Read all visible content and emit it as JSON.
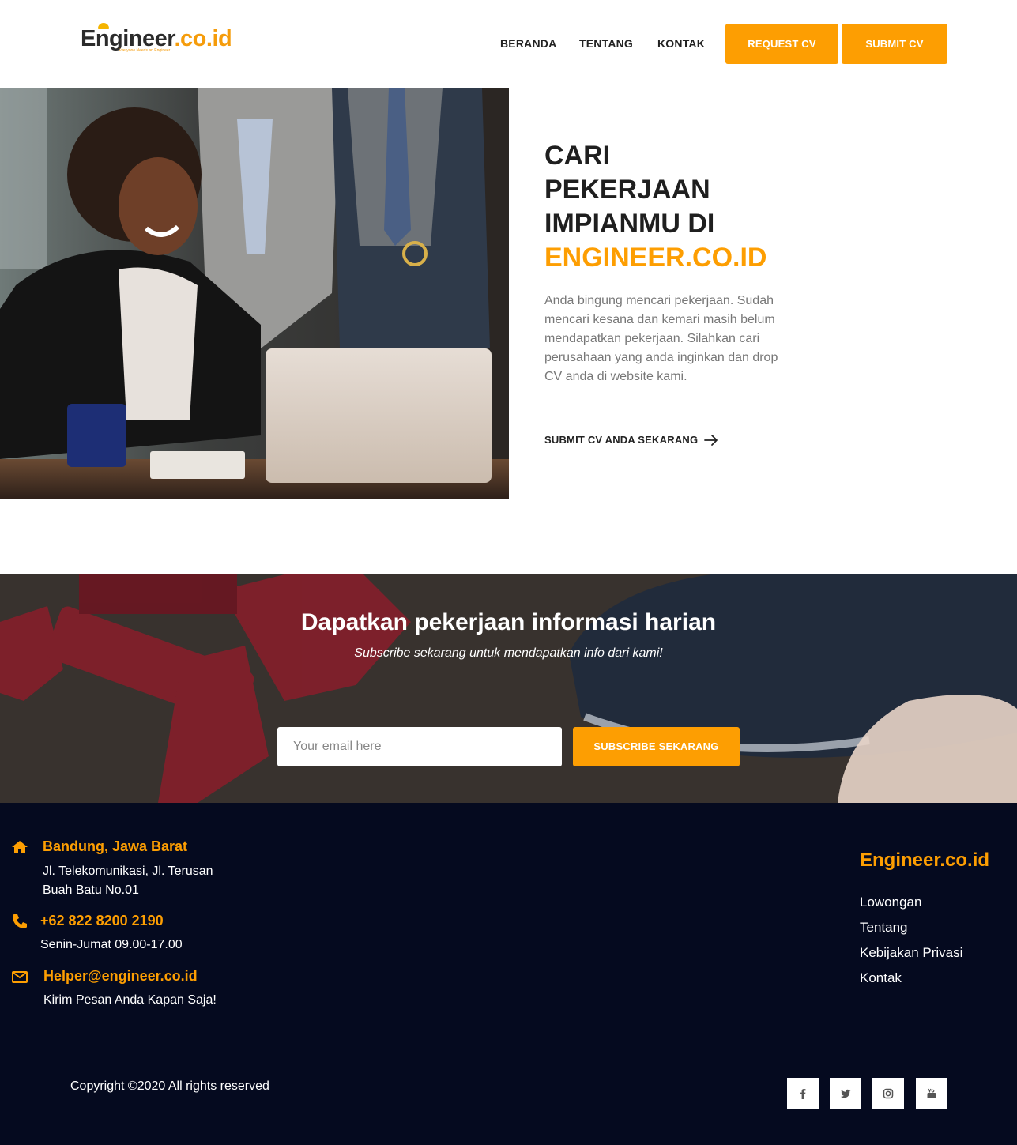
{
  "header": {
    "logo_main_dark": "Engineer",
    "logo_main_orange": ".co.id",
    "logo_tagline": "Everyone Needs an Engineer",
    "nav": {
      "beranda": "BERANDA",
      "tentang": "TENTANG",
      "kontak": "KONTAK"
    },
    "request_cv": "REQUEST CV",
    "submit_cv": "SUBMIT CV"
  },
  "hero": {
    "title_line1": "CARI",
    "title_line2": "PEKERJAAN",
    "title_line3": "IMPIANMU DI",
    "title_accent": "ENGINEER.CO.ID",
    "description": "Anda bingung mencari pekerjaan. Sudah mencari kesana dan kemari masih belum mendapatkan pekerjaan. Silahkan cari perusahaan yang anda inginkan dan drop CV anda di website kami.",
    "cta": "SUBMIT CV ANDA SEKARANG"
  },
  "subscribe": {
    "title": "Dapatkan pekerjaan informasi harian",
    "subtitle": "Subscribe sekarang untuk mendapatkan info dari kami!",
    "email_placeholder": "Your email here",
    "button": "SUBSCRIBE SEKARANG"
  },
  "footer": {
    "address_title": "Bandung, Jawa Barat",
    "address_line1": "Jl. Telekomunikasi, Jl. Terusan",
    "address_line2": "Buah Batu No.01",
    "phone": "+62 822 8200 2190",
    "hours": "Senin-Jumat 09.00-17.00",
    "email": "Helper@engineer.co.id",
    "email_note": "Kirim Pesan Anda Kapan Saja!",
    "brand": "Engineer.co.id",
    "links": [
      "Lowongan",
      "Tentang",
      "Kebijakan Privasi",
      "Kontak"
    ],
    "copyright": "Copyright ©2020 All rights reserved",
    "social": [
      "facebook-icon",
      "twitter-icon",
      "instagram-icon",
      "youtube-icon"
    ]
  },
  "colors": {
    "accent": "#fd9e02",
    "footer_bg": "#050a1f",
    "heading": "#1f1f1f"
  }
}
